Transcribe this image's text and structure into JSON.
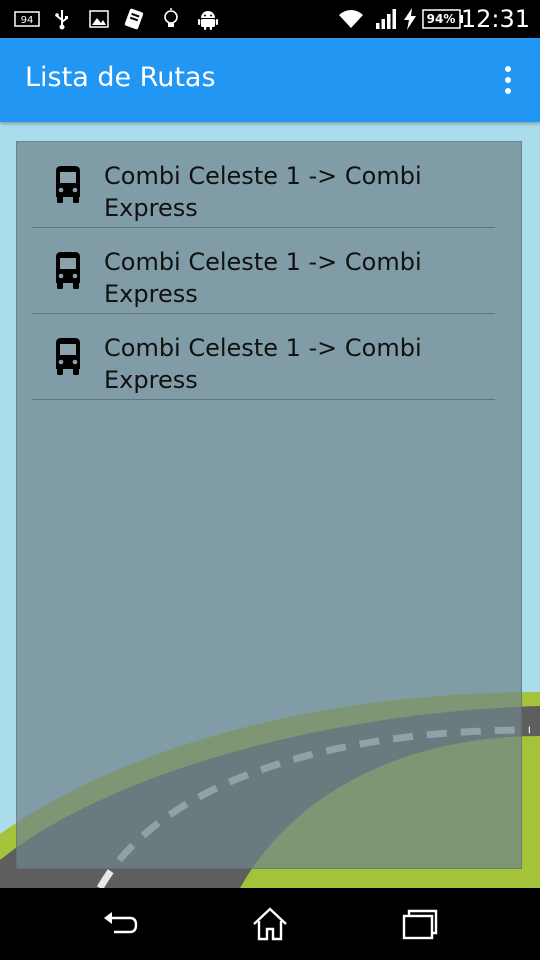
{
  "status_bar": {
    "time": "12:31",
    "battery": "94%",
    "notification_icons": [
      "notification-94-icon",
      "usb-icon",
      "image-icon",
      "app-notification-icon",
      "lightbulb-icon",
      "android-icon"
    ],
    "system_icons": [
      "wifi-icon",
      "signal-icon",
      "charging-icon",
      "battery-icon"
    ]
  },
  "action_bar": {
    "title": "Lista de Rutas",
    "color": "#2196f3",
    "menu_icon": "overflow-menu-icon"
  },
  "routes": [
    {
      "icon": "bus-icon",
      "label": "Combi Celeste 1 -> Combi Express"
    },
    {
      "icon": "bus-icon",
      "label": "Combi Celeste 1 -> Combi Express"
    },
    {
      "icon": "bus-icon",
      "label": "Combi Celeste 1 -> Combi Express"
    }
  ],
  "nav_bar": {
    "buttons": [
      "back-icon",
      "home-icon",
      "recent-apps-icon"
    ]
  },
  "colors": {
    "sky": "#aadceb",
    "grass": "#a4c23a",
    "road": "#5e5e5e",
    "road_dash": "#e8e8e8"
  }
}
